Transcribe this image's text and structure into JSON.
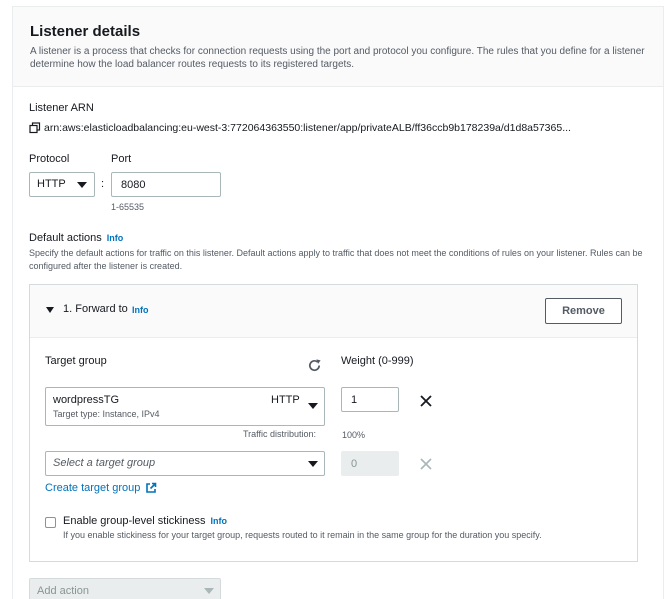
{
  "listener": {
    "title": "Listener details",
    "description": "A listener is a process that checks for connection requests using the port and protocol you configure. The rules that you define for a listener determine how the load balancer routes requests to its registered targets.",
    "arn_label": "Listener ARN",
    "arn_value": "arn:aws:elasticloadbalancing:eu-west-3:772064363550:listener/app/privateALB/ff36ccb9b178239a/d1d8a57365...",
    "protocol_label": "Protocol",
    "protocol_value": "HTTP",
    "separator": ":",
    "port_label": "Port",
    "port_value": "8080",
    "port_hint": "1-65535"
  },
  "default_actions": {
    "label": "Default actions",
    "info": "Info",
    "description": "Specify the default actions for traffic on this listener. Default actions apply to traffic that does not meet the conditions of rules on your listener. Rules can be configured after the listener is created."
  },
  "action": {
    "title": "1. Forward to",
    "info": "Info",
    "remove_label": "Remove",
    "target_group_label": "Target group",
    "weight_label": "Weight (0-999)",
    "target_groups": [
      {
        "name": "wordpressTG",
        "protocol": "HTTP",
        "subtext": "Target type: Instance, IPv4",
        "weight": "1"
      }
    ],
    "traffic_label": "Traffic distribution:",
    "traffic_value": "100%",
    "select_placeholder": "Select a target group",
    "disabled_weight": "0",
    "create_link": "Create target group",
    "stickiness_label": "Enable group-level stickiness",
    "stickiness_info": "Info",
    "stickiness_desc": "If you enable stickiness for your target group, requests routed to it remain in the same group for the duration you specify."
  },
  "add_action": {
    "label": "Add action"
  },
  "colors": {
    "link": "#0073bb",
    "text": "#16191f",
    "muted": "#545b64",
    "border": "#aab7b8"
  }
}
